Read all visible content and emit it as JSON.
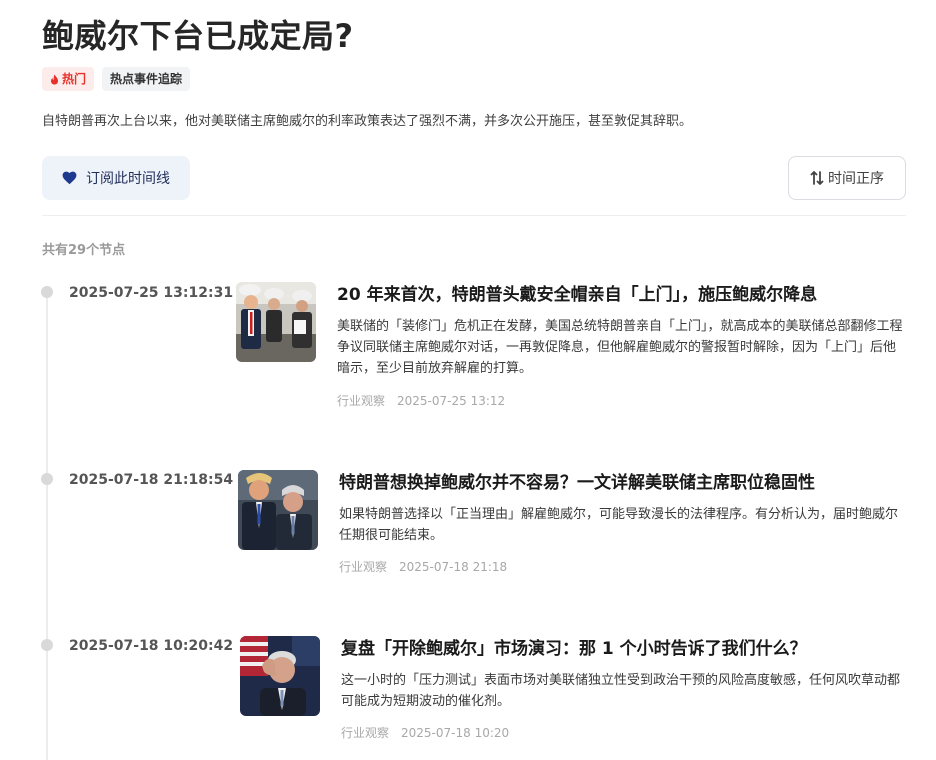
{
  "header": {
    "title": "鲍威尔下台已成定局?",
    "tags": [
      {
        "label": "热门",
        "icon": "fire-icon"
      },
      {
        "label": "热点事件追踪"
      }
    ],
    "intro": "自特朗普再次上台以来，他对美联储主席鲍威尔的利率政策表达了强烈不满，并多次公开施压，甚至敦促其辞职。",
    "subscribe_label": "订阅此时间线",
    "subscribe_icon": "heart-icon",
    "sort_label": "时间正序",
    "sort_icon": "sort-arrows-icon"
  },
  "timeline": {
    "count_label": "共有29个节点",
    "entries": [
      {
        "time": "2025-07-25 13:12:31",
        "headline": "20 年来首次，特朗普头戴安全帽亲自「上门」，施压鲍威尔降息",
        "summary": "美联储的「装修门」危机正在发酵，美国总统特朗普亲自「上门」，就高成本的美联储总部翻修工程争议同联储主席鲍威尔对话，一再敦促降息，但他解雇鲍威尔的警报暂时解除，因为「上门」后他暗示，至少目前放弃解雇的打算。",
        "category": "行业观察",
        "date": "2025-07-25 13:12"
      },
      {
        "time": "2025-07-18 21:18:54",
        "headline": "特朗普想换掉鲍威尔并不容易？一文详解美联储主席职位稳固性",
        "summary": "如果特朗普选择以「正当理由」解雇鲍威尔，可能导致漫长的法律程序。有分析认为，届时鲍威尔任期很可能结束。",
        "category": "行业观察",
        "date": "2025-07-18 21:18"
      },
      {
        "time": "2025-07-18 10:20:42",
        "headline": "复盘「开除鲍威尔」市场演习：那 1 个小时告诉了我们什么？",
        "summary": "这一小时的「压力测试」表面市场对美联储独立性受到政治干预的风险高度敏感，任何风吹草动都可能成为短期波动的催化剂。",
        "category": "行业观察",
        "date": "2025-07-18 10:20"
      }
    ]
  },
  "colors": {
    "hot_red": "#e5332a",
    "subscribe_bg": "#eef2f9",
    "heart_navy": "#1d3a8f"
  }
}
